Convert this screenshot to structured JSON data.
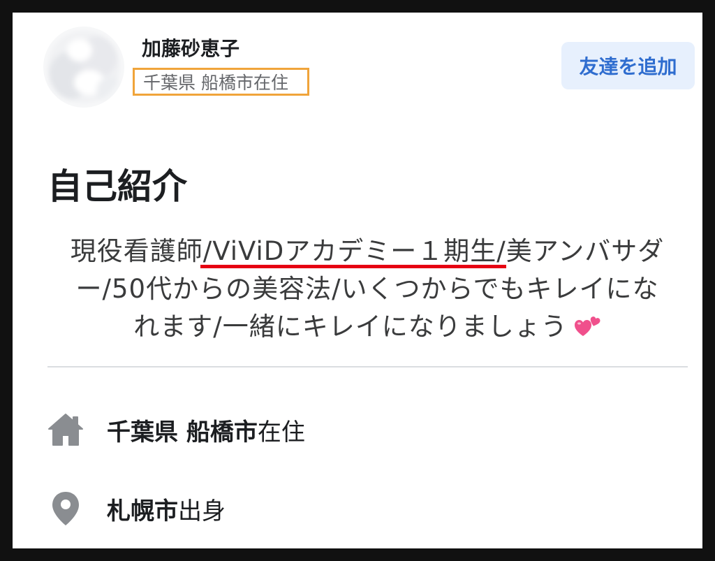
{
  "profile": {
    "name": "加藤砂恵子",
    "subtitle": "千葉県 船橋市在住",
    "add_friend_label": "友達を追加"
  },
  "intro": {
    "heading": "自己紹介",
    "bio_lines": [
      {
        "before": "現役看護師",
        "highlight": "/ViViDアカデミー１期生/",
        "after": "美アンバサダ"
      },
      {
        "text": "ー/50代からの美容法/いくつからでもキレイにな"
      },
      {
        "text": "れます/一緒にキレイになりましょう",
        "emoji_icon": "two-hearts-icon"
      }
    ]
  },
  "details": [
    {
      "icon": "home-icon",
      "bold": "千葉県 船橋市",
      "normal": "在住"
    },
    {
      "icon": "location-pin-icon",
      "bold": "札幌市",
      "normal": "出身"
    }
  ],
  "colors": {
    "frame": "#111111",
    "button_bg": "#e7f0fd",
    "button_text": "#2f6dcf",
    "highlight_underline": "#e60012",
    "highlight_box": "#f0a43a",
    "icon_gray": "#8a8d91",
    "heart_pink": "#f0508c"
  }
}
